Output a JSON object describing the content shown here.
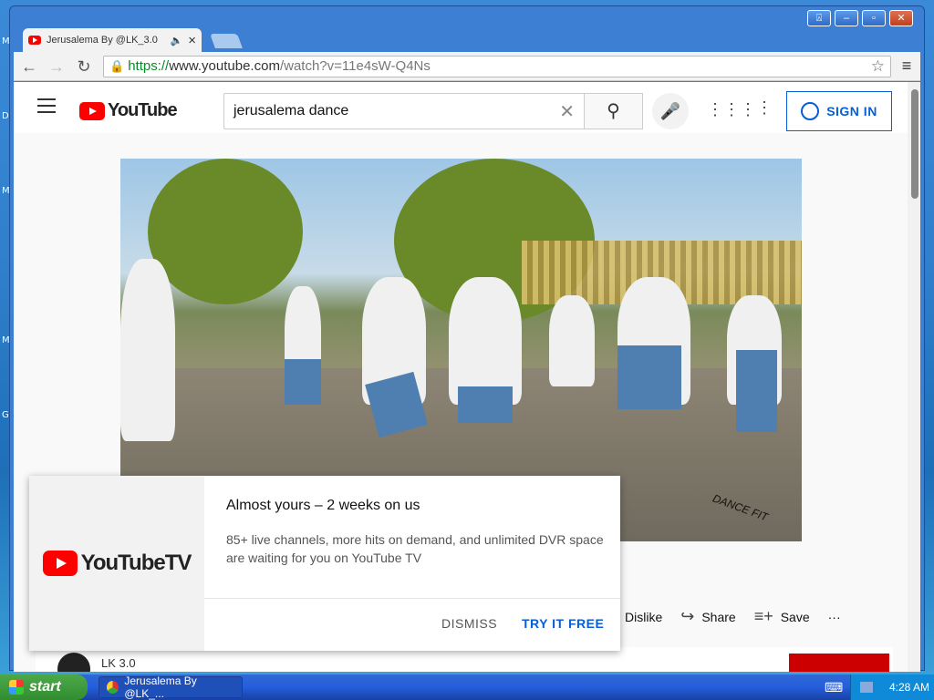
{
  "desktop": {
    "letters": [
      "M",
      "D",
      "M",
      "M",
      "G"
    ]
  },
  "window": {
    "controls": [
      "⍓",
      "–",
      "▫",
      "✕"
    ]
  },
  "browser": {
    "tab": {
      "title": "Jerusalema By @LK_3.0",
      "audio_icon": "speaker-icon",
      "close": "×"
    },
    "url": {
      "scheme": "https://",
      "host": "www.youtube.com",
      "path": "/watch?v=11e4sW-Q4Ns"
    }
  },
  "youtube": {
    "logo_text": "YouTube",
    "search_value": "jerusalema dance",
    "signin_label": "SIGN IN",
    "actions": {
      "dislike": "Dislike",
      "share": "Share",
      "save": "Save"
    },
    "channel_name": "LK 3.0"
  },
  "video": {
    "watermark": "DANCE FIT"
  },
  "promo": {
    "logo_text": "YouTubeTV",
    "title": "Almost yours – 2 weeks on us",
    "body": "85+ live channels, more hits on demand, and unlimited DVR space are waiting for you on YouTube TV",
    "dismiss": "DISMISS",
    "try_free": "TRY IT FREE"
  },
  "taskbar": {
    "start_label": "start",
    "task_title": "Jerusalema By @LK_...",
    "clock": "4:28 AM"
  },
  "colors": {
    "yt_red": "#ff0000",
    "link_blue": "#065fd4"
  }
}
